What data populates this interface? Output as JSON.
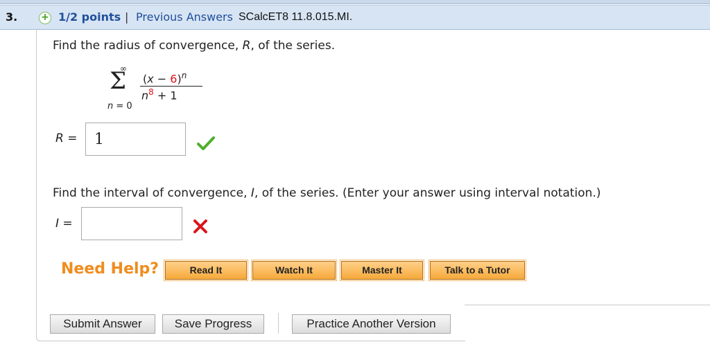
{
  "header": {
    "number": "3.",
    "points": "1/2 points",
    "separator": "|",
    "previous_answers": "Previous Answers",
    "code": "SCalcET8 11.8.015.MI."
  },
  "question1": {
    "text_before": "Find the radius of convergence, ",
    "var": "R",
    "text_after": ", of the series.",
    "series": {
      "upper": "∞",
      "sigma": "Σ",
      "lower_var": "n",
      "lower_rest": " = 0",
      "num_open": "(",
      "num_x": "x",
      "num_minus": " − ",
      "num_6": "6",
      "num_close": ")",
      "num_exp": "n",
      "den_n": "n",
      "den_exp": "8",
      "den_rest": " + 1"
    },
    "label_var": "R",
    "label_eq": " =",
    "answer": "1",
    "status": "correct"
  },
  "question2": {
    "text_before": "Find the interval of convergence, ",
    "var": "I",
    "text_after": ", of the series. (Enter your answer using interval notation.)",
    "label_var": "I",
    "label_eq": " =",
    "answer": "",
    "status": "incorrect"
  },
  "help": {
    "title": "Need Help?",
    "buttons": [
      "Read It",
      "Watch It",
      "Master It",
      "Talk to a Tutor"
    ]
  },
  "actions": {
    "submit": "Submit Answer",
    "save": "Save Progress",
    "practice": "Practice Another Version"
  },
  "colors": {
    "accent_orange": "#f08c1e",
    "link_blue": "#1f4f9b",
    "correct_green": "#4fae2b",
    "incorrect_red": "#d9151a"
  }
}
